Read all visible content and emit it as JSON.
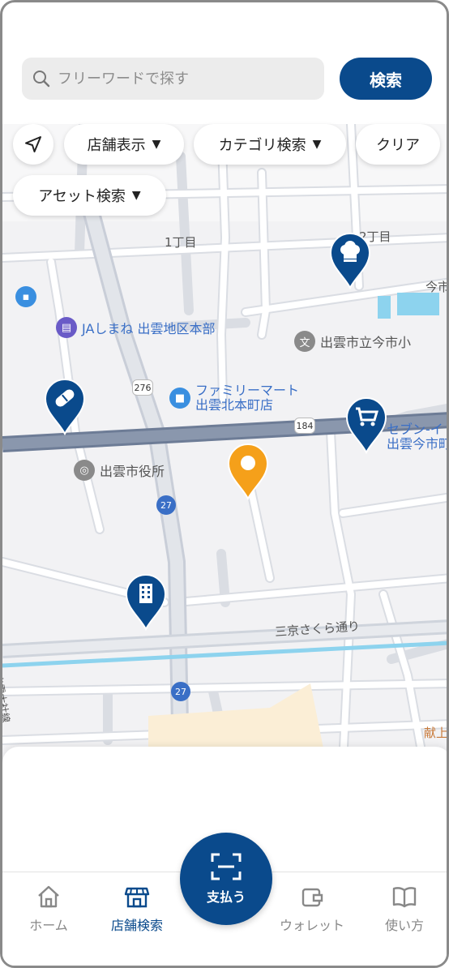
{
  "search": {
    "placeholder": "フリーワードで探す",
    "button_label": "検索"
  },
  "filters": {
    "store_display": "店舗表示",
    "category_search": "カテゴリ検索",
    "clear": "クリア",
    "asset_search": "アセット検索"
  },
  "map": {
    "labels": {
      "chome1": "1丁目",
      "chome2": "2丁目",
      "imaichi_edge": "今市",
      "ja": "JAしまね 出雲地区本部",
      "school": "出雲市立今市小",
      "famima1": "ファミリーマート",
      "famima2": "出雲北本町店",
      "seven1": "セブン-イ",
      "seven2": "出雲今市町",
      "city_hall": "出雲市役所",
      "sakura": "三京さくら通り",
      "kenjo": "献上",
      "vertical_left": "出雲大社線"
    },
    "routes": {
      "r276": "276",
      "r184": "184",
      "r27a": "27",
      "r27b": "27"
    },
    "pin_colors": {
      "brand": "#0a4a8c",
      "current": "#f5a01a"
    }
  },
  "tabs": {
    "home": "ホーム",
    "store_search": "店舗検索",
    "pay": "支払う",
    "wallet": "ウォレット",
    "howto": "使い方"
  },
  "colors": {
    "brand": "#0a4a8c",
    "inactive": "#888888"
  }
}
